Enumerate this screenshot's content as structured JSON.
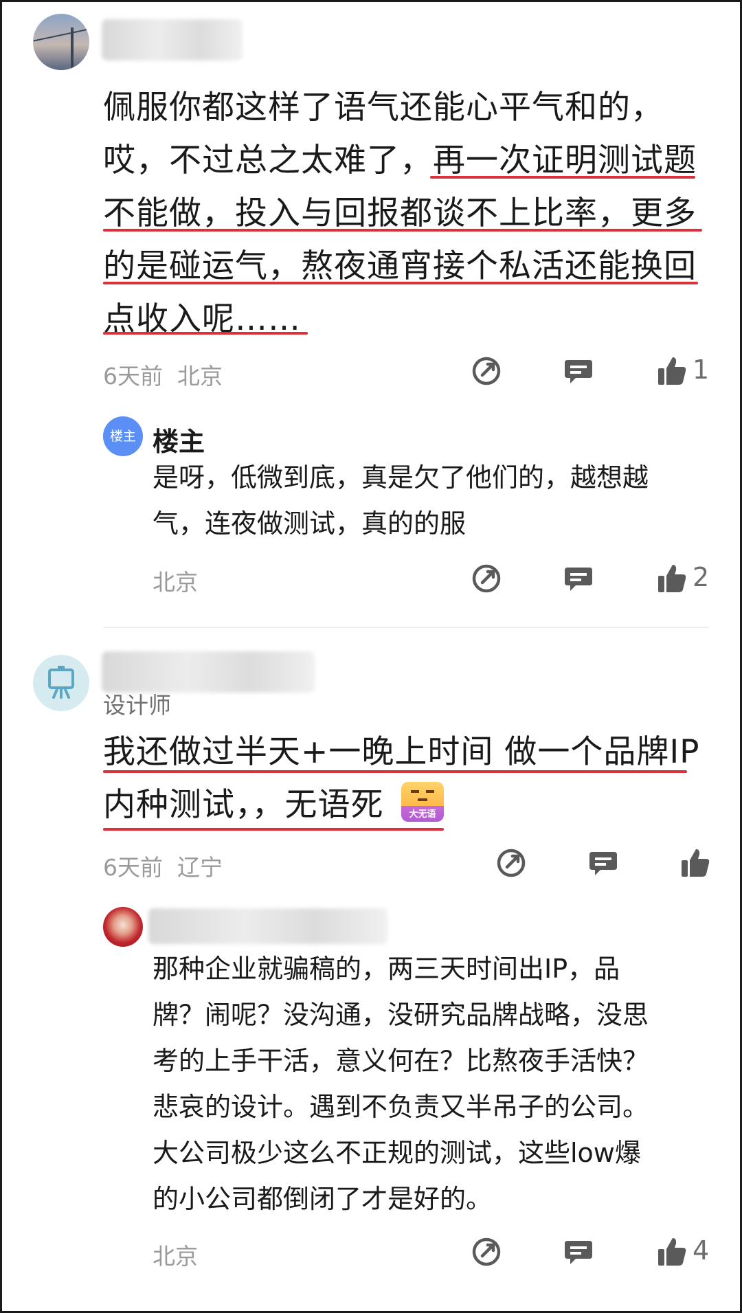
{
  "comments": [
    {
      "text": "佩服你都这样了语气还能心平气和的，\n哎，不过总之太难了，再一次证明测试题\n不能做，投入与回报都谈不上比率，更多\n的是碰运气，熬夜通宵接个私活还能换回\n点收入呢……",
      "time": "6天前",
      "location": "北京",
      "likes": "1",
      "reply": {
        "badge": "楼主",
        "author": "楼主",
        "text": "是呀，低微到底，真是欠了他们的，越想越\n气，连夜做测试，真的的服",
        "location": "北京",
        "likes": "2"
      }
    },
    {
      "role": "设计师",
      "text": "我还做过半天+一晚上时间  做一个品牌IP\n内种测试，，无语死",
      "emoji_label": "大无语",
      "time": "6天前",
      "location": "辽宁",
      "likes": "",
      "reply": {
        "text": "那种企业就骗稿的，两三天时间出IP，品\n牌？闹呢？没沟通，没研究品牌战略，没思\n考的上手干活，意义何在？比熬夜手活快？\n悲哀的设计。遇到不负责又半吊子的公司。\n大公司极少这么不正规的测试，这些low爆\n的小公司都倒闭了才是好的。",
        "location": "北京",
        "likes": "4"
      }
    }
  ],
  "icons": [
    "share-icon",
    "reply-icon",
    "thumbs-up-icon"
  ],
  "colors": {
    "underline": "#d9323a",
    "badge": "#5b8ff5",
    "meta": "#9a9a9a"
  }
}
